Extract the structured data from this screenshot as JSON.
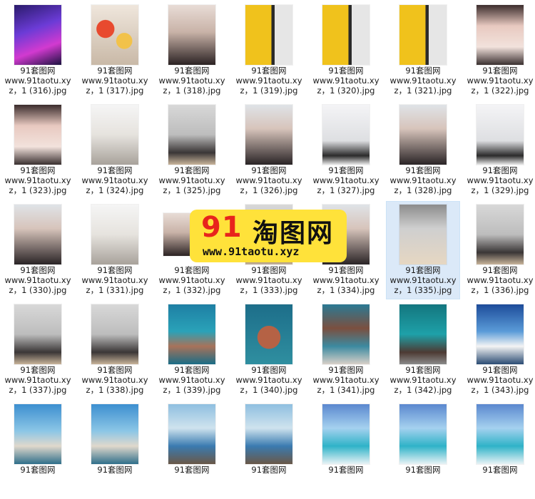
{
  "caption_title": "91套图网",
  "watermark": {
    "number": "91",
    "name": "淘图网",
    "url": "www.91taotu.xyz"
  },
  "files": [
    {
      "line2": "www.91taotu.xy",
      "line3": "z，1 (316).jpg",
      "theme": "neon"
    },
    {
      "line2": "www.91taotu.xy",
      "line3": "z，1 (317).jpg",
      "theme": "food"
    },
    {
      "line2": "www.91taotu.xy",
      "line3": "z，1 (318).jpg",
      "theme": "portrait"
    },
    {
      "line2": "www.91taotu.xy",
      "line3": "z，1 (319).jpg",
      "theme": "yellow"
    },
    {
      "line2": "www.91taotu.xy",
      "line3": "z，1 (320).jpg",
      "theme": "yellow"
    },
    {
      "line2": "www.91taotu.xy",
      "line3": "z，1 (321).jpg",
      "theme": "yellow"
    },
    {
      "line2": "www.91taotu.xy",
      "line3": "z，1 (322).jpg",
      "theme": "selfie"
    },
    {
      "line2": "www.91taotu.xy",
      "line3": "z，1 (323).jpg",
      "theme": "selfie"
    },
    {
      "line2": "www.91taotu.xy",
      "line3": "z，1 (324).jpg",
      "theme": "cafe"
    },
    {
      "line2": "www.91taotu.xy",
      "line3": "z，1 (325).jpg",
      "theme": "gray"
    },
    {
      "line2": "www.91taotu.xy",
      "line3": "z，1 (326).jpg",
      "theme": "duo"
    },
    {
      "line2": "www.91taotu.xy",
      "line3": "z，1 (327).jpg",
      "theme": "white"
    },
    {
      "line2": "www.91taotu.xy",
      "line3": "z，1 (328).jpg",
      "theme": "duo"
    },
    {
      "line2": "www.91taotu.xy",
      "line3": "z，1 (329).jpg",
      "theme": "white"
    },
    {
      "line2": "www.91taotu.xy",
      "line3": "z，1 (330).jpg",
      "theme": "duo"
    },
    {
      "line2": "www.91taotu.xy",
      "line3": "z，1 (331).jpg",
      "theme": "cafe"
    },
    {
      "line2": "www.91taotu.xy",
      "line3": "z，1 (332).jpg",
      "theme": "portrait",
      "wide": true
    },
    {
      "line2": "www.91taotu.xy",
      "line3": "z，1 (333).jpg",
      "theme": "gray"
    },
    {
      "line2": "www.91taotu.xy",
      "line3": "z，1 (334).jpg",
      "theme": "duo"
    },
    {
      "line2": "www.91taotu.xy",
      "line3": "z，1 (335).jpg",
      "theme": "room",
      "selected": true
    },
    {
      "line2": "www.91taotu.xy",
      "line3": "z，1 (336).jpg",
      "theme": "gray"
    },
    {
      "line2": "www.91taotu.xy",
      "line3": "z，1 (337).jpg",
      "theme": "gray"
    },
    {
      "line2": "www.91taotu.xy",
      "line3": "z，1 (338).jpg",
      "theme": "gray"
    },
    {
      "line2": "www.91taotu.xy",
      "line3": "z，1 (339).jpg",
      "theme": "ocean"
    },
    {
      "line2": "www.91taotu.xy",
      "line3": "z，1 (340).jpg",
      "theme": "fort"
    },
    {
      "line2": "www.91taotu.xy",
      "line3": "z，1 (341).jpg",
      "theme": "rocks"
    },
    {
      "line2": "www.91taotu.xy",
      "line3": "z，1 (342).jpg",
      "theme": "wave"
    },
    {
      "line2": "www.91taotu.xy",
      "line3": "z，1 (343).jpg",
      "theme": "sky"
    },
    {
      "theme": "beach"
    },
    {
      "theme": "beach"
    },
    {
      "theme": "pier"
    },
    {
      "theme": "pier"
    },
    {
      "theme": "sea"
    },
    {
      "theme": "sea"
    },
    {
      "theme": "sea"
    }
  ]
}
